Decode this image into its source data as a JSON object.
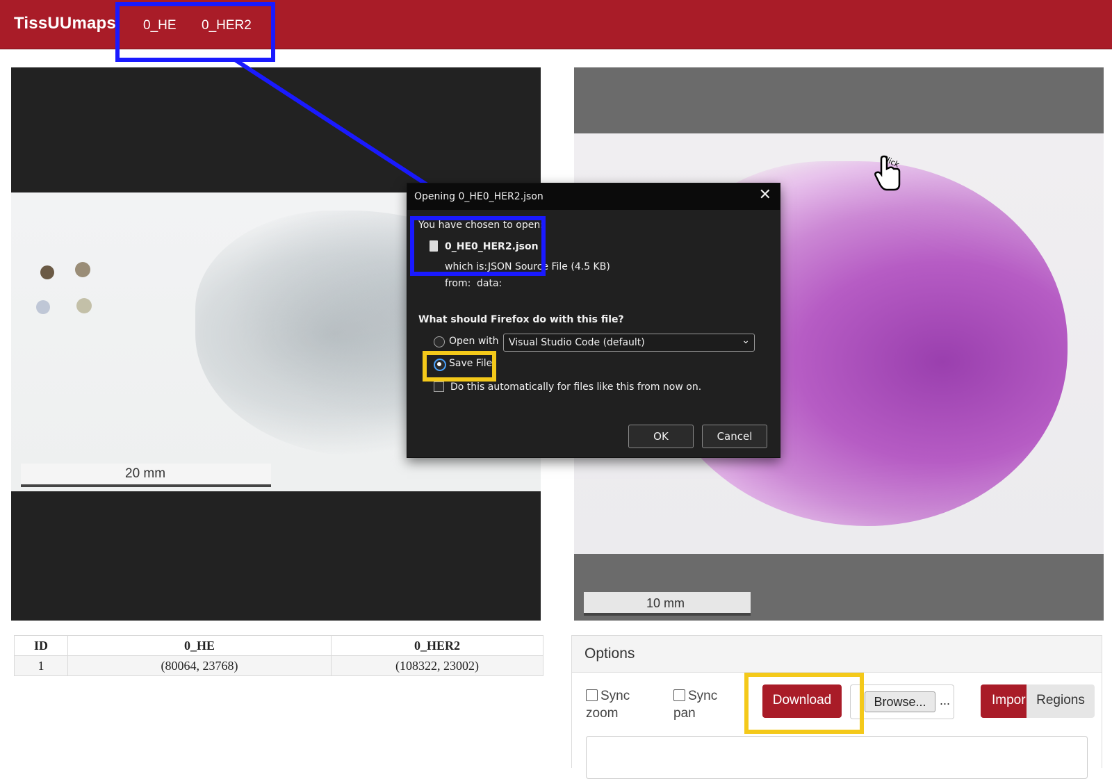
{
  "navbar": {
    "brand": "TissUUmaps",
    "links": [
      "0_HE",
      "0_HER2"
    ]
  },
  "viewers": {
    "left": {
      "scale_label": "20 mm"
    },
    "right": {
      "scale_label": "10 mm",
      "click_hint": "Click"
    }
  },
  "table": {
    "headers": [
      "ID",
      "0_HE",
      "0_HER2"
    ],
    "rows": [
      [
        "1",
        "(80064, 23768)",
        "(108322, 23002)"
      ]
    ]
  },
  "options": {
    "title": "Options",
    "sync_zoom": [
      "Sync",
      "zoom"
    ],
    "sync_pan": [
      "Sync",
      "pan"
    ],
    "download": "Download",
    "browse": "Browse...",
    "browse_status": "...",
    "import": "Impor",
    "regions": "Regions"
  },
  "dialog": {
    "title": "Opening 0_HE0_HER2.json",
    "chosen_label": "You have chosen to open:",
    "filename": "0_HE0_HER2.json",
    "which_is_label": "which is:",
    "which_is_value": "JSON Source File (4.5 KB)",
    "from_label": "from:",
    "from_value": "data:",
    "question": "What should Firefox do with this file?",
    "open_with_label": "Open with",
    "open_with_app": "Visual Studio Code (default)",
    "save_file_label": "Save File",
    "auto_label": "Do this automatically for files like this from now on.",
    "ok": "OK",
    "cancel": "Cancel"
  },
  "colors": {
    "brand_red": "#a91c28",
    "highlight_blue": "#1a1aff",
    "highlight_yellow": "#f4c91a"
  }
}
